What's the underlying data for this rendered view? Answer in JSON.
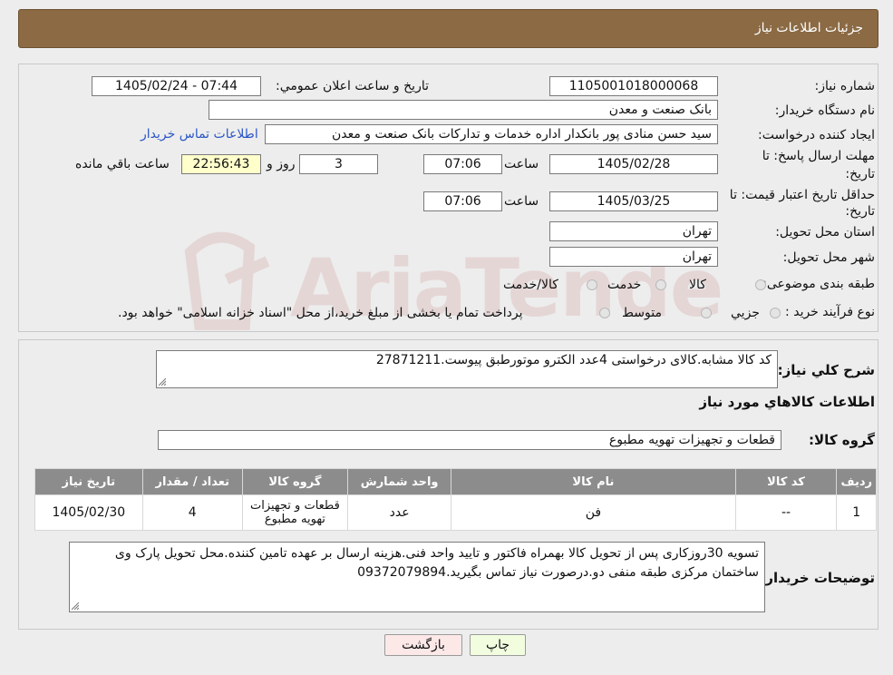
{
  "header": {
    "title": "جزئیات اطلاعات نیاز"
  },
  "watermark": {
    "text": "AriaTender.neT",
    "color": "#e3caca"
  },
  "form": {
    "need_number_label": "شماره نیاز:",
    "need_number": "1105001018000068",
    "announce_label": "تاریخ و ساعت اعلان عمومي:",
    "announce_value": "1405/02/24 - 07:44",
    "buyer_org_label": "نام دستگاه خريدار:",
    "buyer_org": "بانک صنعت و معدن",
    "creator_label": "ايجاد کننده درخواست:",
    "creator": "سید حسن منادی پور بانکدار اداره خدمات و تداركات بانک صنعت و معدن",
    "contact_link": "اطلاعات تماس خريدار",
    "deadline_label_1": "مهلت ارسال پاسخ: تا",
    "deadline_label_2": "تاريخ:",
    "deadline_date": "1405/02/28",
    "time_label": "ساعت",
    "deadline_time": "07:06",
    "days_value": "3",
    "days_label": "روز و",
    "remaining_time": "22:56:43",
    "remaining_label": "ساعت باقي مانده",
    "validity_label_1": "حداقل تاريخ اعتبار قيمت: تا",
    "validity_label_2": "تاريخ:",
    "validity_date": "1405/03/25",
    "validity_time": "07:06",
    "province_label": "استان محل تحويل:",
    "province": "تهران",
    "city_label": "شهر محل تحويل:",
    "city": "تهران",
    "category_label": "طبقه بندی موضوعی:",
    "category_options": [
      "کالا",
      "خدمت",
      "کالا/خدمت"
    ],
    "process_label": "نوع فرآيند خريد :",
    "process_options": [
      "جزيي",
      "متوسط"
    ],
    "process_note": "پرداخت تمام يا بخشی از مبلغ خريد،از محل \"اسناد خزانه اسلامی\" خواهد بود."
  },
  "description": {
    "label": "شرح کلي نياز:",
    "value": "کد کالا مشابه.کالای درخواستی 4عدد الکترو موتورطبق پیوست.27871211"
  },
  "goods_section_title": "اطلاعات کالاهاي مورد نياز",
  "goods_group": {
    "label": "گروه کالا:",
    "value": "قطعات و تجهيزات تهويه مطبوع"
  },
  "table": {
    "headers": [
      "رديف",
      "کد کالا",
      "نام کالا",
      "واحد شمارش",
      "گروه کالا",
      "تعداد / مقدار",
      "تاريخ نياز"
    ],
    "rows": [
      {
        "row": "1",
        "code": "--",
        "name": "فن",
        "unit": "عدد",
        "group": "قطعات و تجهيزات تهويه مطبوع",
        "qty": "4",
        "date": "1405/02/30"
      }
    ]
  },
  "buyer_notes": {
    "label": "توضيحات خريدار:",
    "value": "تسویه 30روزکاری پس از تحویل کالا بهمراه فاکتور و تایید واحد فنی.هزینه ارسال بر عهده تامین کننده.محل تحویل پارک وی ساختمان مرکزی طبقه منفی دو.درصورت نیاز تماس بگیرید.09372079894"
  },
  "buttons": {
    "print": "چاپ",
    "back": "بازگشت"
  },
  "colors": {
    "header_bg": "#8b6a44",
    "link": "#2a56c6",
    "print_bg": "#f2fde0",
    "back_bg": "#fde8e8",
    "table_header": "#8c8c8c",
    "remaining_bg": "#ffffcc"
  }
}
